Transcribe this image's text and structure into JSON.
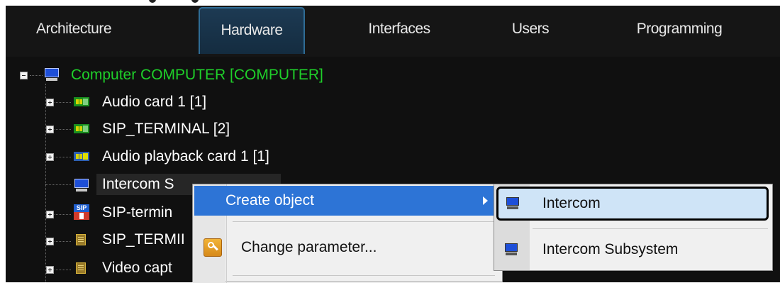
{
  "tabs": [
    {
      "label": "Architecture",
      "active": false
    },
    {
      "label": "Hardware",
      "active": true
    },
    {
      "label": "Interfaces",
      "active": false
    },
    {
      "label": "Users",
      "active": false
    },
    {
      "label": "Programming",
      "active": false
    }
  ],
  "tree": {
    "root": {
      "label": "Computer COMPUTER [COMPUTER]",
      "icon": "monitor-icon",
      "color": "#1fd02a"
    },
    "children": [
      {
        "label": "Audio card 1 [1]",
        "icon": "audio-card-icon"
      },
      {
        "label": "SIP_TERMINAL [2]",
        "icon": "audio-card-icon"
      },
      {
        "label": "Audio playback card 1 [1]",
        "icon": "playback-card-icon"
      },
      {
        "label": "Intercom S",
        "icon": "intercom-monitor-icon",
        "selected": true
      },
      {
        "label": "SIP-termin",
        "icon": "sip-terminal-icon"
      },
      {
        "label": "SIP_TERMII",
        "icon": "chip-icon"
      },
      {
        "label": "Video capt",
        "icon": "chip-icon"
      }
    ]
  },
  "context_menu": {
    "items": [
      {
        "label": "Create object",
        "highlighted": true,
        "has_submenu": true
      },
      {
        "label": "Change parameter...",
        "icon": "key-icon"
      }
    ]
  },
  "submenu": {
    "items": [
      {
        "label": "Intercom",
        "icon": "monitor-icon",
        "highlighted": true
      },
      {
        "label": "Intercom Subsystem",
        "icon": "monitor-icon"
      }
    ]
  }
}
